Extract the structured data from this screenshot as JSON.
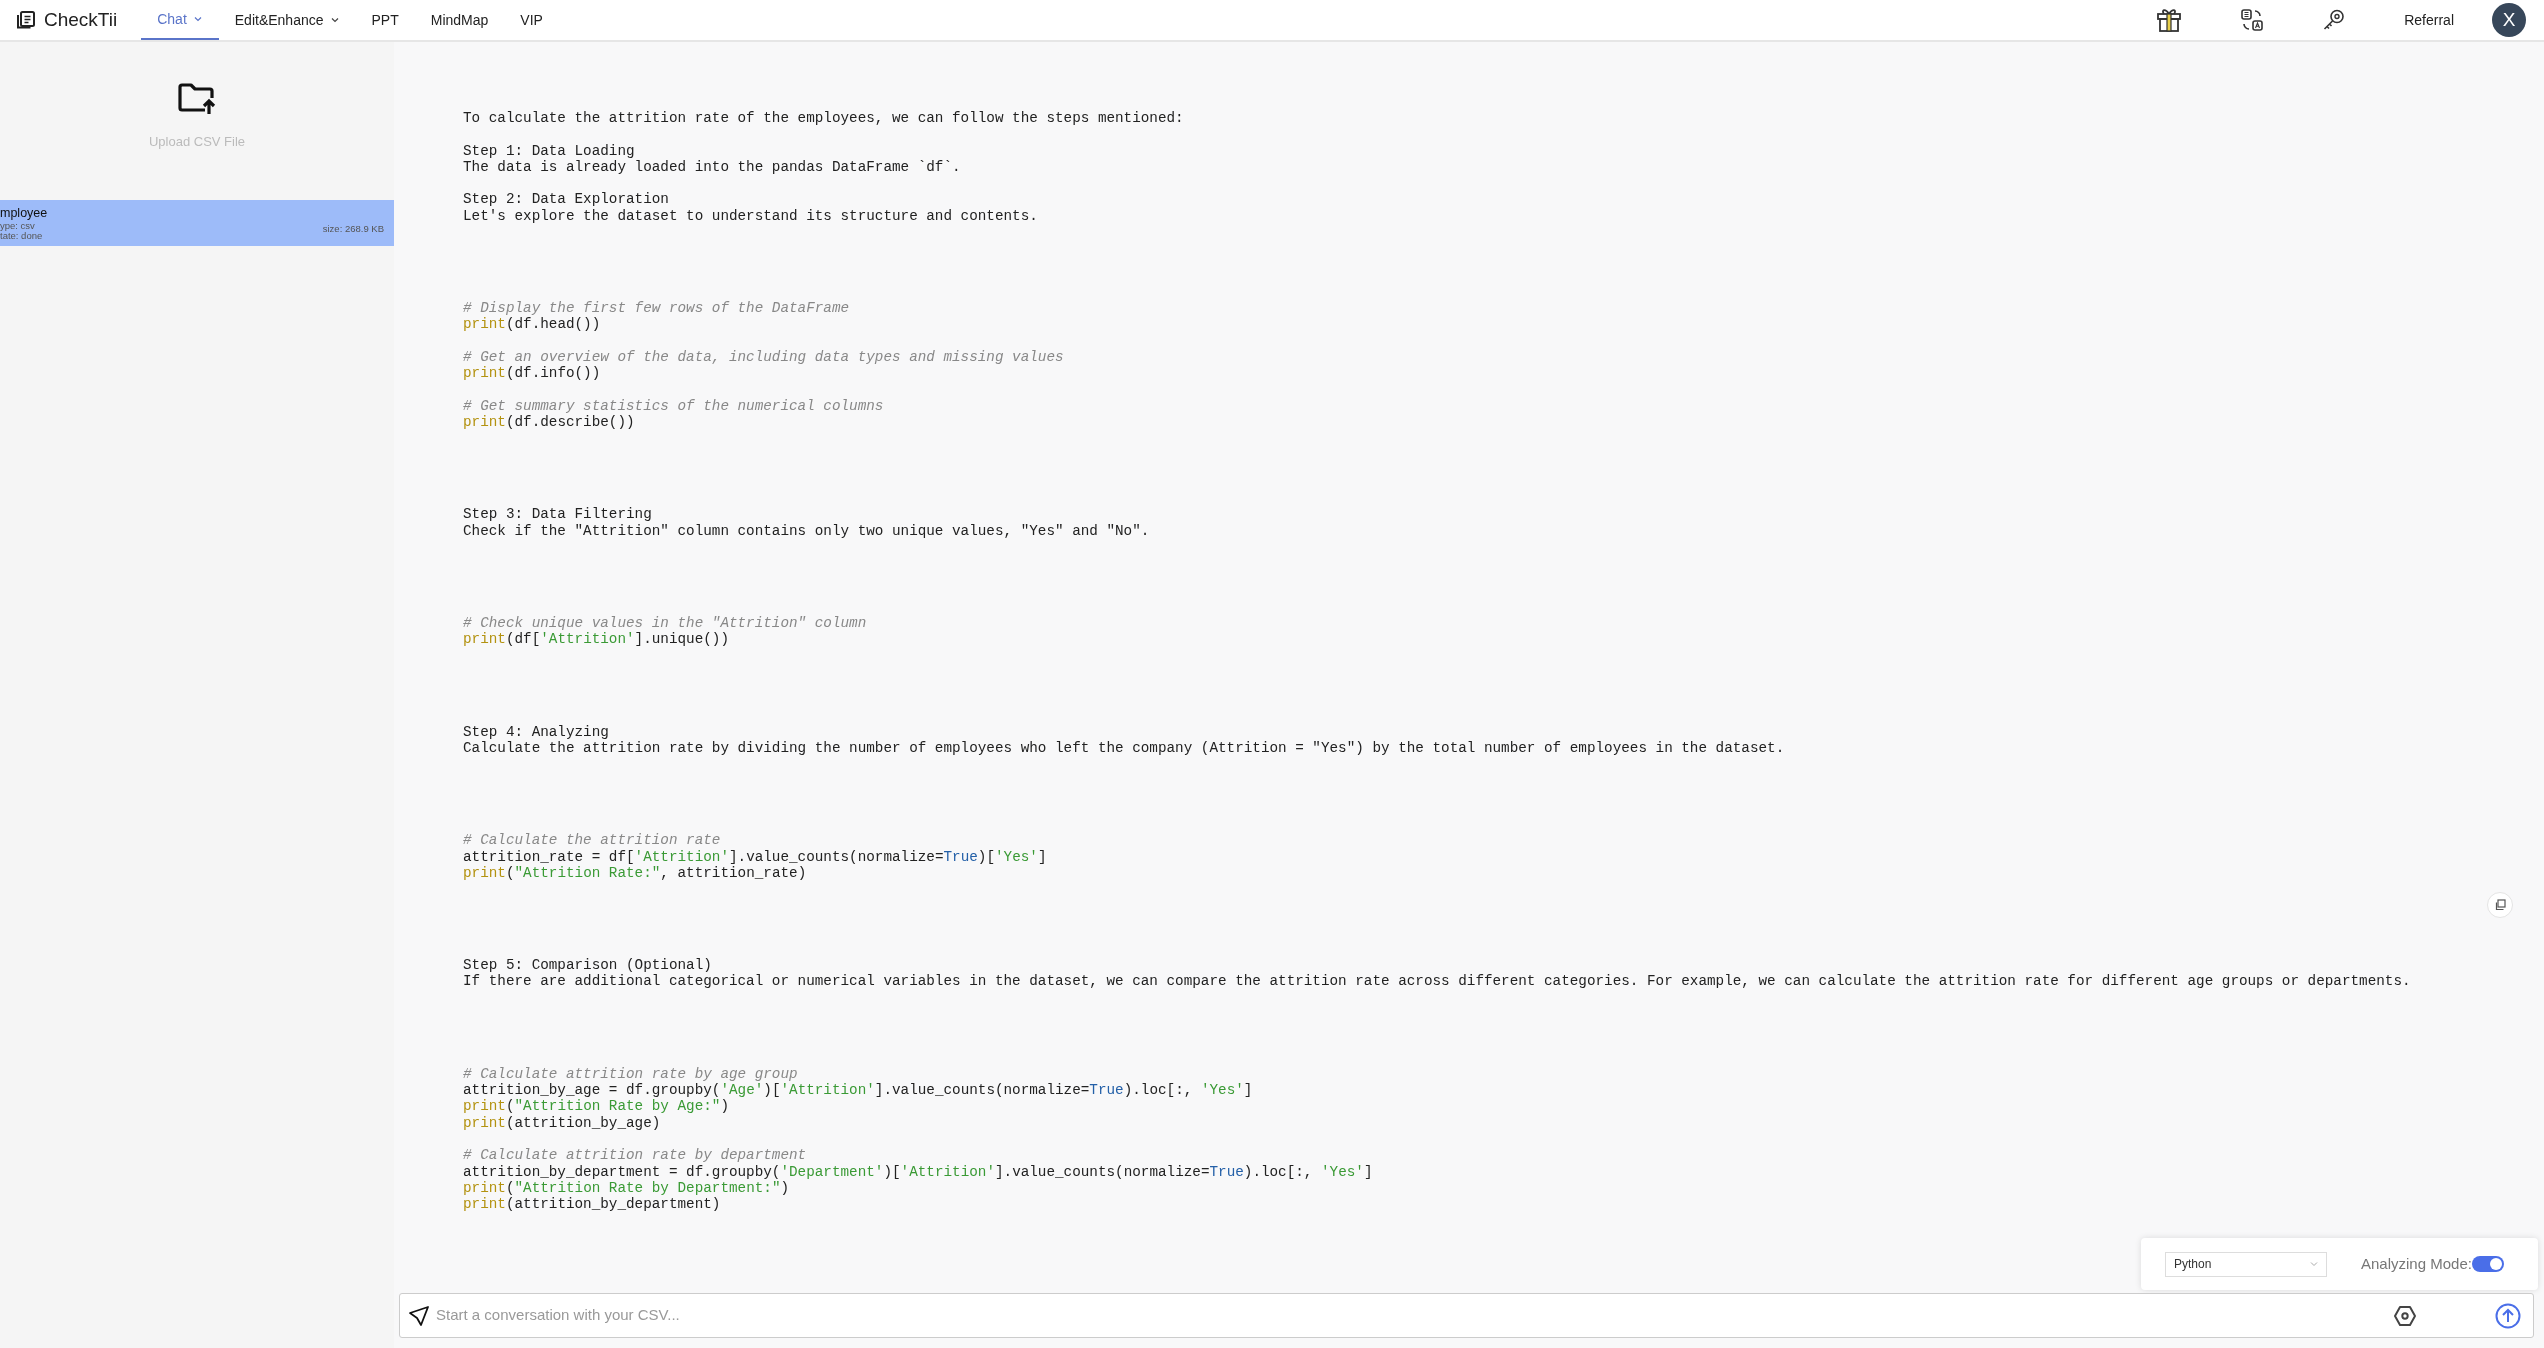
{
  "app": {
    "name": "CheckTii"
  },
  "nav": [
    {
      "label": "Chat",
      "selected": true,
      "dropdown": true
    },
    {
      "label": "Edit&Enhance",
      "selected": false,
      "dropdown": true
    },
    {
      "label": "PPT",
      "selected": false,
      "dropdown": false
    },
    {
      "label": "MindMap",
      "selected": false,
      "dropdown": false
    },
    {
      "label": "VIP",
      "selected": false,
      "dropdown": false
    }
  ],
  "header_right": {
    "link": "Referral",
    "avatar": "X"
  },
  "sidebar": {
    "upload_label": "Upload CSV File",
    "files": [
      {
        "name": "mployee",
        "type": "ype: csv",
        "state": "tate: done",
        "size": "size: 268.9 KB",
        "selected": true
      }
    ]
  },
  "content": [
    {
      "kind": "text",
      "paragraphs": [
        [
          "To calculate the attrition rate of the employees, we can follow the steps mentioned:"
        ],
        [
          "Step 1: Data Loading",
          "The data is already loaded into the pandas DataFrame `df`."
        ],
        [
          "Step 2: Data Exploration",
          "Let's explore the dataset to understand its structure and contents."
        ]
      ]
    },
    {
      "kind": "code",
      "groups": [
        [
          [
            {
              "kind": "comment",
              "text": "# Display the first few rows of the DataFrame"
            }
          ],
          [
            {
              "kind": "builtin",
              "text": "print"
            },
            {
              "kind": "plain",
              "text": "(df.head())"
            }
          ]
        ],
        [
          [
            {
              "kind": "comment",
              "text": "# Get an overview of the data, including data types and missing values"
            }
          ],
          [
            {
              "kind": "builtin",
              "text": "print"
            },
            {
              "kind": "plain",
              "text": "(df.info())"
            }
          ]
        ],
        [
          [
            {
              "kind": "comment",
              "text": "# Get summary statistics of the numerical columns"
            }
          ],
          [
            {
              "kind": "builtin",
              "text": "print"
            },
            {
              "kind": "plain",
              "text": "(df.describe())"
            }
          ]
        ]
      ]
    },
    {
      "kind": "text",
      "paragraphs": [
        [
          "Step 3: Data Filtering",
          "Check if the \"Attrition\" column contains only two unique values, \"Yes\" and \"No\"."
        ]
      ]
    },
    {
      "kind": "code",
      "groups": [
        [
          [
            {
              "kind": "comment",
              "text": "# Check unique values in the \"Attrition\" column"
            }
          ],
          [
            {
              "kind": "builtin",
              "text": "print"
            },
            {
              "kind": "plain",
              "text": "(df["
            },
            {
              "kind": "string",
              "text": "'Attrition'"
            },
            {
              "kind": "plain",
              "text": "].unique())"
            }
          ]
        ]
      ]
    },
    {
      "kind": "text",
      "paragraphs": [
        [
          "Step 4: Analyzing",
          "Calculate the attrition rate by dividing the number of employees who left the company (Attrition = \"Yes\") by the total number of employees in the dataset."
        ]
      ]
    },
    {
      "kind": "code",
      "groups": [
        [
          [
            {
              "kind": "comment",
              "text": "# Calculate the attrition rate"
            }
          ],
          [
            {
              "kind": "plain",
              "text": "attrition_rate = df["
            },
            {
              "kind": "string",
              "text": "'Attrition'"
            },
            {
              "kind": "plain",
              "text": "].value_counts(normalize="
            },
            {
              "kind": "keyword",
              "text": "True"
            },
            {
              "kind": "plain",
              "text": ")["
            },
            {
              "kind": "string",
              "text": "'Yes'"
            },
            {
              "kind": "plain",
              "text": "]"
            }
          ],
          [
            {
              "kind": "builtin",
              "text": "print"
            },
            {
              "kind": "plain",
              "text": "("
            },
            {
              "kind": "string",
              "text": "\"Attrition Rate:\""
            },
            {
              "kind": "plain",
              "text": ", attrition_rate)"
            }
          ]
        ]
      ]
    },
    {
      "kind": "text",
      "paragraphs": [
        [
          "Step 5: Comparison (Optional)",
          "If there are additional categorical or numerical variables in the dataset, we can compare the attrition rate across different categories. For example, we can calculate the attrition rate for different age groups or departments."
        ]
      ]
    },
    {
      "kind": "code",
      "groups": [
        [
          [
            {
              "kind": "comment",
              "text": "# Calculate attrition rate by age group"
            }
          ],
          [
            {
              "kind": "plain",
              "text": "attrition_by_age = df.groupby("
            },
            {
              "kind": "string",
              "text": "'Age'"
            },
            {
              "kind": "plain",
              "text": ")["
            },
            {
              "kind": "string",
              "text": "'Attrition'"
            },
            {
              "kind": "plain",
              "text": "].value_counts(normalize="
            },
            {
              "kind": "keyword",
              "text": "True"
            },
            {
              "kind": "plain",
              "text": ").loc[:, "
            },
            {
              "kind": "string",
              "text": "'Yes'"
            },
            {
              "kind": "plain",
              "text": "]"
            }
          ],
          [
            {
              "kind": "builtin",
              "text": "print"
            },
            {
              "kind": "plain",
              "text": "("
            },
            {
              "kind": "string",
              "text": "\"Attrition Rate by Age:\""
            },
            {
              "kind": "plain",
              "text": ")"
            }
          ],
          [
            {
              "kind": "builtin",
              "text": "print"
            },
            {
              "kind": "plain",
              "text": "(attrition_by_age)"
            }
          ]
        ],
        [
          [
            {
              "kind": "comment",
              "text": "# Calculate attrition rate by department"
            }
          ],
          [
            {
              "kind": "plain",
              "text": "attrition_by_department = df.groupby("
            },
            {
              "kind": "string",
              "text": "'Department'"
            },
            {
              "kind": "plain",
              "text": ")["
            },
            {
              "kind": "string",
              "text": "'Attrition'"
            },
            {
              "kind": "plain",
              "text": "].value_counts(normalize="
            },
            {
              "kind": "keyword",
              "text": "True"
            },
            {
              "kind": "plain",
              "text": ").loc[:, "
            },
            {
              "kind": "string",
              "text": "'Yes'"
            },
            {
              "kind": "plain",
              "text": "]"
            }
          ],
          [
            {
              "kind": "builtin",
              "text": "print"
            },
            {
              "kind": "plain",
              "text": "("
            },
            {
              "kind": "string",
              "text": "\"Attrition Rate by Department:\""
            },
            {
              "kind": "plain",
              "text": ")"
            }
          ],
          [
            {
              "kind": "builtin",
              "text": "print"
            },
            {
              "kind": "plain",
              "text": "(attrition_by_department)"
            }
          ]
        ]
      ]
    }
  ],
  "language_select": {
    "value": "Python"
  },
  "analyzing_mode": {
    "label": "Analyzing Mode:",
    "on": true
  },
  "chat_input": {
    "placeholder": "Start a conversation with your CSV..."
  }
}
